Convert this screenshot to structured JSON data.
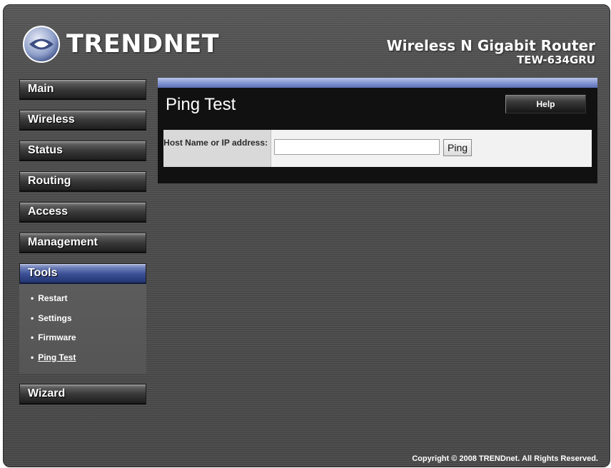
{
  "header": {
    "logo_text": "TRENDNET",
    "product_name": "Wireless N Gigabit Router",
    "model": "TEW-634GRU"
  },
  "nav": {
    "main": "Main",
    "wireless": "Wireless",
    "status": "Status",
    "routing": "Routing",
    "access": "Access",
    "management": "Management",
    "tools": "Tools",
    "tools_items": [
      "Restart",
      "Settings",
      "Firmware",
      "Ping Test"
    ],
    "wizard": "Wizard"
  },
  "panel": {
    "title": "Ping Test",
    "help_label": "Help",
    "host_label": "Host Name or IP address:",
    "host_value": "",
    "ping_label": "Ping"
  },
  "footer": {
    "copyright": "Copyright © 2008 TRENDnet. All Rights Reserved."
  },
  "colors": {
    "accent": "#3a4f95",
    "panel_bar": "#8597d3"
  }
}
